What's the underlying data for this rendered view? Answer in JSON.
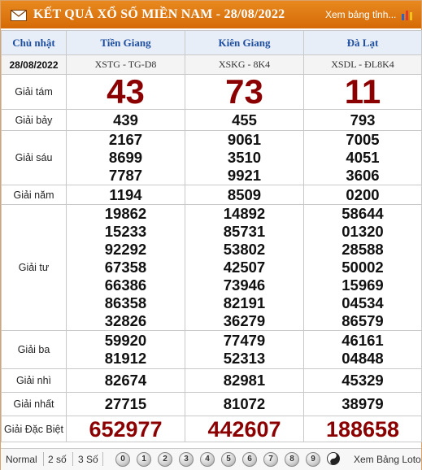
{
  "header": {
    "title": "KẾT QUẢ XỔ SỐ MIỀN NAM - 28/08/2022",
    "more_link": "Xem bảng tỉnh...",
    "colors": {
      "bar": "#e07a12",
      "number_red": "#8b0000",
      "header_blue": "#1e4fa0"
    }
  },
  "table": {
    "day": "Chủ nhật",
    "date": "28/08/2022",
    "provinces": [
      {
        "name": "Tiền Giang",
        "code": "XSTG - TG-D8"
      },
      {
        "name": "Kiên Giang",
        "code": "XSKG - 8K4"
      },
      {
        "name": "Đà Lạt",
        "code": "XSDL - ĐL8K4"
      }
    ],
    "prizes": [
      {
        "label": "Giải tám",
        "values": [
          [
            "43"
          ],
          [
            "73"
          ],
          [
            "11"
          ]
        ]
      },
      {
        "label": "Giải bảy",
        "values": [
          [
            "439"
          ],
          [
            "455"
          ],
          [
            "793"
          ]
        ]
      },
      {
        "label": "Giải sáu",
        "values": [
          [
            "2167",
            "8699",
            "7787"
          ],
          [
            "9061",
            "3510",
            "9921"
          ],
          [
            "7005",
            "4051",
            "3606"
          ]
        ]
      },
      {
        "label": "Giải năm",
        "values": [
          [
            "1194"
          ],
          [
            "8509"
          ],
          [
            "0200"
          ]
        ]
      },
      {
        "label": "Giải tư",
        "values": [
          [
            "19862",
            "15233",
            "92292",
            "67358",
            "66386",
            "86358",
            "32826"
          ],
          [
            "14892",
            "85731",
            "53802",
            "42507",
            "73946",
            "82191",
            "36279"
          ],
          [
            "58644",
            "01320",
            "28588",
            "50002",
            "15969",
            "04534",
            "86579"
          ]
        ]
      },
      {
        "label": "Giải ba",
        "values": [
          [
            "59920",
            "81912"
          ],
          [
            "77479",
            "52313"
          ],
          [
            "46161",
            "04848"
          ]
        ]
      },
      {
        "label": "Giải nhì",
        "values": [
          [
            "82674"
          ],
          [
            "82981"
          ],
          [
            "45329"
          ]
        ]
      },
      {
        "label": "Giải nhất",
        "values": [
          [
            "27715"
          ],
          [
            "81072"
          ],
          [
            "38979"
          ]
        ]
      },
      {
        "label": "Giải Đặc Biệt",
        "values": [
          [
            "652977"
          ],
          [
            "442607"
          ],
          [
            "188658"
          ]
        ]
      }
    ]
  },
  "footer": {
    "normal": "Normal",
    "two": "2 số",
    "three": "3 Số",
    "digits": [
      "0",
      "1",
      "2",
      "3",
      "4",
      "5",
      "6",
      "7",
      "8",
      "9"
    ],
    "loto": "Xem Bảng Loto"
  }
}
